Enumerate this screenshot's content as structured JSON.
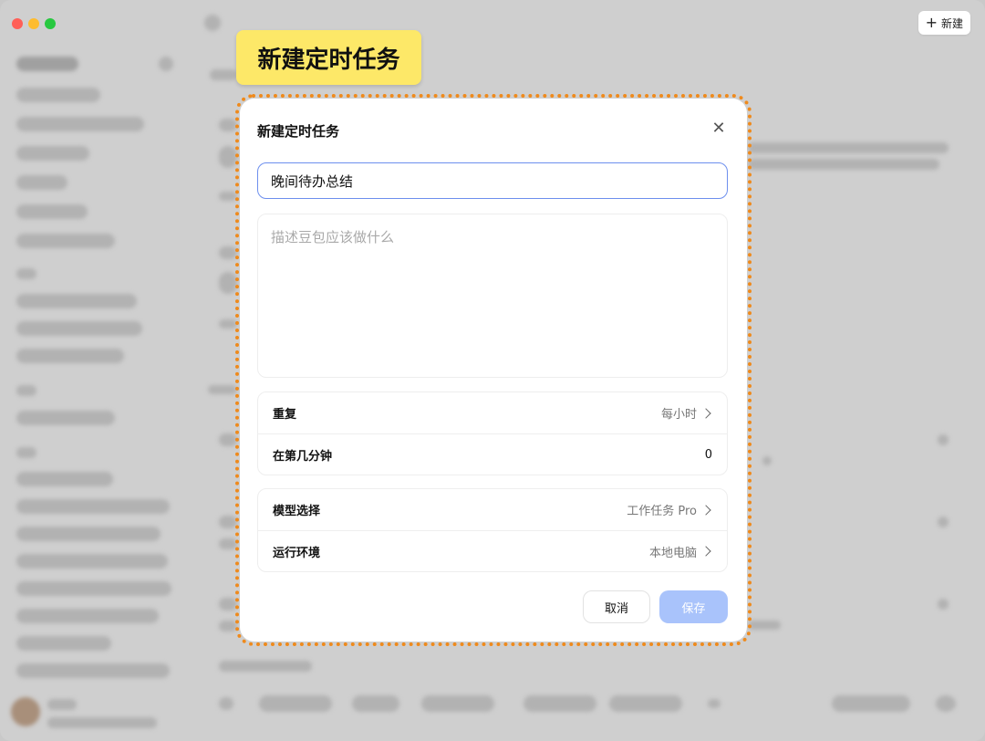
{
  "window": {
    "new_button_label": "新建"
  },
  "callout": {
    "text": "新建定时任务"
  },
  "dialog": {
    "title": "新建定时任务",
    "name_value": "晚间待办总结",
    "description_placeholder": "描述豆包应该做什么",
    "schedule": [
      {
        "label": "重复",
        "value": "每小时",
        "has_chevron": true
      },
      {
        "label": "在第几分钟",
        "value": "0",
        "has_chevron": false
      }
    ],
    "settings": [
      {
        "label": "模型选择",
        "value": "工作任务 Pro",
        "has_chevron": true
      },
      {
        "label": "运行环境",
        "value": "本地电脑",
        "has_chevron": true
      }
    ],
    "cancel_label": "取消",
    "save_label": "保存"
  },
  "colors": {
    "accent": "#6d8fee",
    "save_disabled": "#a9c3fb",
    "callout": "#fde868",
    "highlight_border": "#ef8a1c"
  }
}
